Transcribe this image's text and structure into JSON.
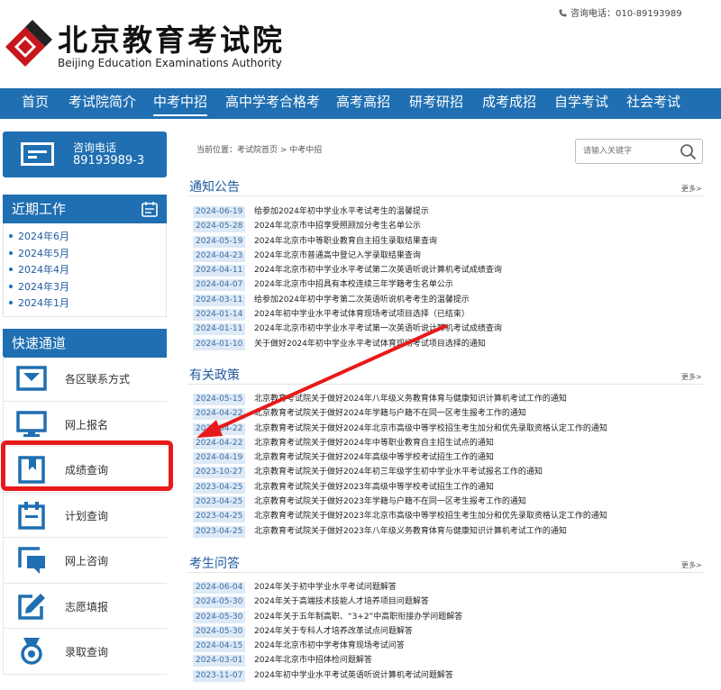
{
  "header": {
    "hotline": "咨询电话：010-89193989",
    "title": "北京教育考试院",
    "subtitle": "Beijing Education Examinations Authority"
  },
  "nav": [
    {
      "label": "首页"
    },
    {
      "label": "考试院简介"
    },
    {
      "label": "中考中招"
    },
    {
      "label": "高中学考合格考"
    },
    {
      "label": "高考高招"
    },
    {
      "label": "研考研招"
    },
    {
      "label": "成考成招"
    },
    {
      "label": "自学考试"
    },
    {
      "label": "社会考试"
    }
  ],
  "sidebar": {
    "hotline_label": "咨询电话",
    "hotline_number": "89193989-3",
    "recent_title": "近期工作",
    "recent_items": [
      "2024年6月",
      "2024年5月",
      "2024年4月",
      "2024年3月",
      "2024年1月"
    ],
    "quick_title": "快速通道",
    "quick_items": [
      {
        "label": "各区联系方式",
        "icon": "inbox-icon"
      },
      {
        "label": "网上报名",
        "icon": "monitor-icon"
      },
      {
        "label": "成绩查询",
        "icon": "bookmark-icon"
      },
      {
        "label": "计划查询",
        "icon": "calendar-icon"
      },
      {
        "label": "网上咨询",
        "icon": "chat-icon"
      },
      {
        "label": "志愿填报",
        "icon": "edit-icon"
      },
      {
        "label": "录取查询",
        "icon": "badge-icon"
      }
    ]
  },
  "main": {
    "breadcrumb": "当前位置：考试院首页 > 中考中招",
    "search_placeholder": "请输入关键字",
    "more_label": "更多>",
    "sections": [
      {
        "title": "通知公告",
        "items": [
          {
            "date": "2024-06-19",
            "title": "给参加2024年初中学业水平考试考生的温馨提示"
          },
          {
            "date": "2024-05-28",
            "title": "2024年北京市中招享受照顾加分考生名单公示"
          },
          {
            "date": "2024-05-19",
            "title": "2024年北京市中等职业教育自主招生录取结果查询"
          },
          {
            "date": "2024-04-23",
            "title": "2024年北京市普通高中登记入学录取结果查询"
          },
          {
            "date": "2024-04-11",
            "title": "2024年北京市初中学业水平考试第二次英语听说计算机考试成绩查询"
          },
          {
            "date": "2024-04-07",
            "title": "2024年北京市中招具有本校连续三年学籍考生名单公示"
          },
          {
            "date": "2024-03-11",
            "title": "给参加2024年初中学考第二次英语听说机考考生的温馨提示"
          },
          {
            "date": "2024-01-14",
            "title": "2024年初中学业水平考试体育现场考试项目选择（已结束）"
          },
          {
            "date": "2024-01-11",
            "title": "2024年北京市初中学业水平考试第一次英语听说计算机考试成绩查询"
          },
          {
            "date": "2024-01-10",
            "title": "关于做好2024年初中学业水平考试体育现场考试项目选择的通知"
          }
        ]
      },
      {
        "title": "有关政策",
        "items": [
          {
            "date": "2024-05-15",
            "title": "北京教育考试院关于做好2024年八年级义务教育体育与健康知识计算机考试工作的通知"
          },
          {
            "date": "2024-04-22",
            "title": "北京教育考试院关于做好2024年学籍与户籍不在同一区考生报考工作的通知"
          },
          {
            "date": "2024-04-22",
            "title": "北京教育考试院关于做好2024年北京市高级中等学校招生考生加分和优先录取资格认定工作的通知"
          },
          {
            "date": "2024-04-22",
            "title": "北京教育考试院关于做好2024年中等职业教育自主招生试点的通知"
          },
          {
            "date": "2024-04-19",
            "title": "北京教育考试院关于做好2024年高级中等学校考试招生工作的通知"
          },
          {
            "date": "2023-10-27",
            "title": "北京教育考试院关于做好2024年初三年级学生初中学业水平考试报名工作的通知"
          },
          {
            "date": "2023-04-25",
            "title": "北京教育考试院关于做好2023年高级中等学校考试招生工作的通知"
          },
          {
            "date": "2023-04-25",
            "title": "北京教育考试院关于做好2023年学籍与户籍不在同一区考生报考工作的通知"
          },
          {
            "date": "2023-04-25",
            "title": "北京教育考试院关于做好2023年北京市高级中等学校招生考生加分和优先录取资格认定工作的通知"
          },
          {
            "date": "2023-04-25",
            "title": "北京教育考试院关于做好2023年八年级义务教育体育与健康知识计算机考试工作的通知"
          }
        ]
      },
      {
        "title": "考生问答",
        "items": [
          {
            "date": "2024-06-04",
            "title": "2024年关于初中学业水平考试问题解答"
          },
          {
            "date": "2024-05-30",
            "title": "2024年关于高端技术技能人才培养项目问题解答"
          },
          {
            "date": "2024-05-30",
            "title": "2024年关于五年制高职、“3+2”中高职衔接办学问题解答"
          },
          {
            "date": "2024-05-30",
            "title": "2024年关于专科人才培养改革试点问题解答"
          },
          {
            "date": "2024-04-15",
            "title": "2024年北京市初中学考体育现场考试问答"
          },
          {
            "date": "2024-03-01",
            "title": "2024年北京市中招体检问题解答"
          },
          {
            "date": "2023-11-07",
            "title": "2024年初中学业水平考试英语听说计算机考试问题解答"
          }
        ]
      }
    ]
  },
  "annotation": {
    "highlight_color": "#e8191a",
    "accent": "#1f6fb2"
  }
}
